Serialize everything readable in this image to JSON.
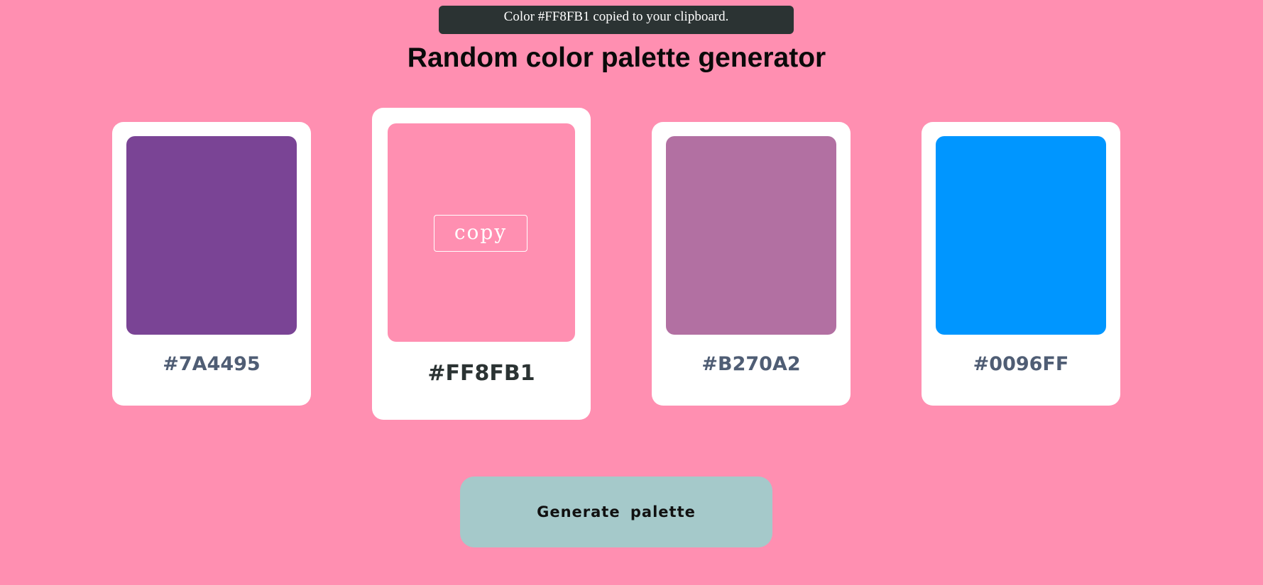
{
  "toast": {
    "message": "Color #FF8FB1 copied to your clipboard."
  },
  "header": {
    "title": "Random color palette generator"
  },
  "palette": [
    {
      "hex": "#7A4495",
      "color": "#7A4495"
    },
    {
      "hex": "#FF8FB1",
      "color": "#FF8FB1",
      "hovered": true,
      "copy_label": "copy"
    },
    {
      "hex": "#B270A2",
      "color": "#B270A2"
    },
    {
      "hex": "#0096FF",
      "color": "#0096FF"
    }
  ],
  "actions": {
    "generate_label": "Generate palette"
  },
  "colors": {
    "background": "#FF8FB1",
    "button": "#A5C9CA",
    "toast": "#2B3333"
  }
}
